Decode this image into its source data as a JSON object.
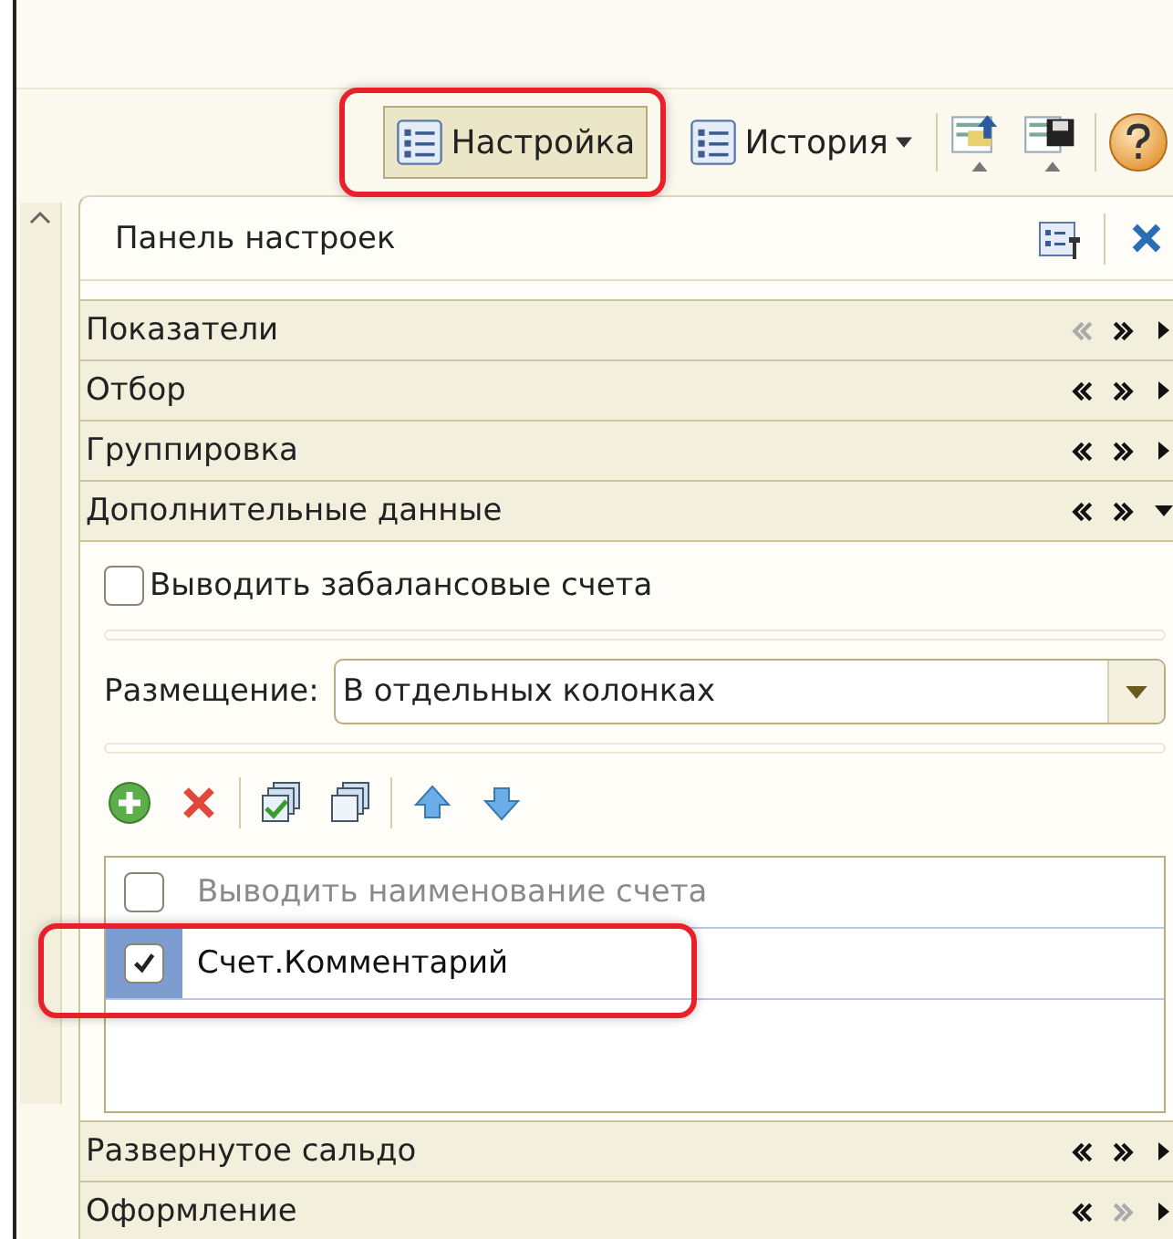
{
  "toolbar": {
    "buttons": [
      {
        "label": "Настройка",
        "pressed": true,
        "has_menu": false,
        "highlighted": true
      },
      {
        "label": "История",
        "pressed": false,
        "has_menu": true,
        "highlighted": false
      }
    ]
  },
  "panel": {
    "title": "Панель настроек",
    "sections": [
      {
        "title": "Показатели",
        "expanded": false,
        "up_enabled": false,
        "down_enabled": true
      },
      {
        "title": "Отбор",
        "expanded": false,
        "up_enabled": true,
        "down_enabled": true
      },
      {
        "title": "Группировка",
        "expanded": false,
        "up_enabled": true,
        "down_enabled": true
      },
      {
        "title": "Дополнительные данные",
        "expanded": true,
        "up_enabled": true,
        "down_enabled": true,
        "content": {
          "checkbox": {
            "label": "Выводить забалансовые счета",
            "checked": false
          },
          "placement": {
            "label": "Размещение:",
            "value": "В отдельных колонках"
          },
          "list": [
            {
              "label": "Выводить наименование счета",
              "checked": false,
              "selected": false,
              "highlighted": false
            },
            {
              "label": "Счет.Комментарий",
              "checked": true,
              "selected": true,
              "highlighted": true
            }
          ]
        }
      },
      {
        "title": "Развернутое сальдо",
        "expanded": false,
        "up_enabled": true,
        "down_enabled": true
      },
      {
        "title": "Оформление",
        "expanded": false,
        "up_enabled": true,
        "down_enabled": false
      }
    ]
  }
}
